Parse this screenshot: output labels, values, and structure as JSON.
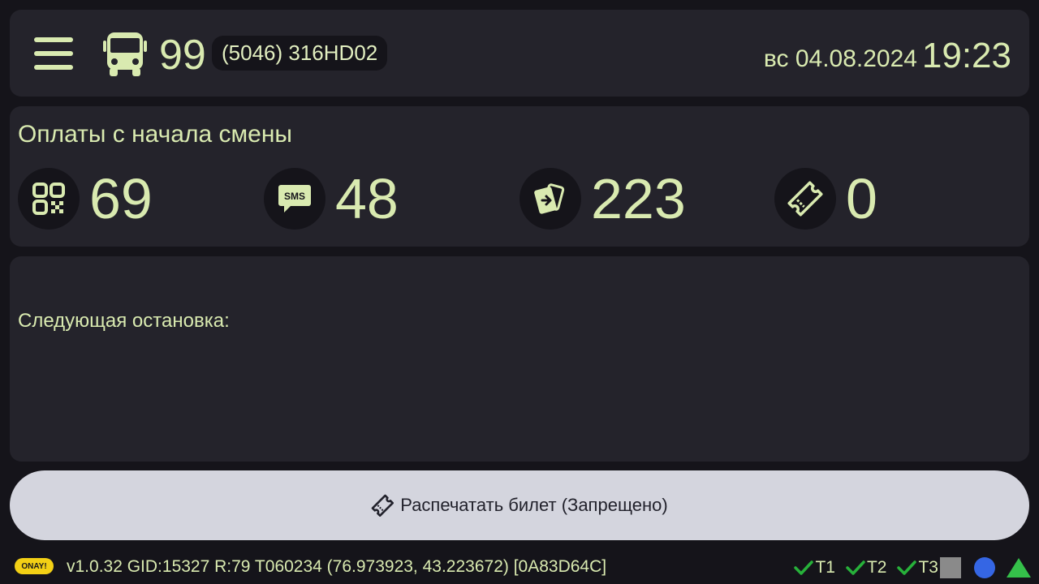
{
  "header": {
    "route_number": "99",
    "vehicle_id": "(5046) 316HD02",
    "date": "вс 04.08.2024",
    "time": "19:23"
  },
  "payments": {
    "title": "Оплаты с начала смены",
    "items": [
      {
        "icon": "qr-code-icon",
        "value": "69"
      },
      {
        "icon": "sms-icon",
        "value": "48"
      },
      {
        "icon": "card-icon",
        "value": "223"
      },
      {
        "icon": "ticket-icon",
        "value": "0"
      }
    ]
  },
  "next_stop": {
    "label": "Следующая остановка:"
  },
  "print_button": {
    "label": "Распечатать билет (Запрещено)"
  },
  "status_bar": {
    "logo_text": "ONAY!",
    "info": "v1.0.32  GID:15327  R:79  T060234  (76.973923, 43.223672)  [0A83D64C]",
    "indicators": [
      "T1",
      "T2",
      "T3"
    ]
  },
  "colors": {
    "background": "#15141a",
    "panel": "#24232b",
    "accent_text": "#d9eab0",
    "button": "#d4d5de",
    "check_green": "#27b13a",
    "status_blue": "#3566e4",
    "status_green": "#35c04a"
  }
}
